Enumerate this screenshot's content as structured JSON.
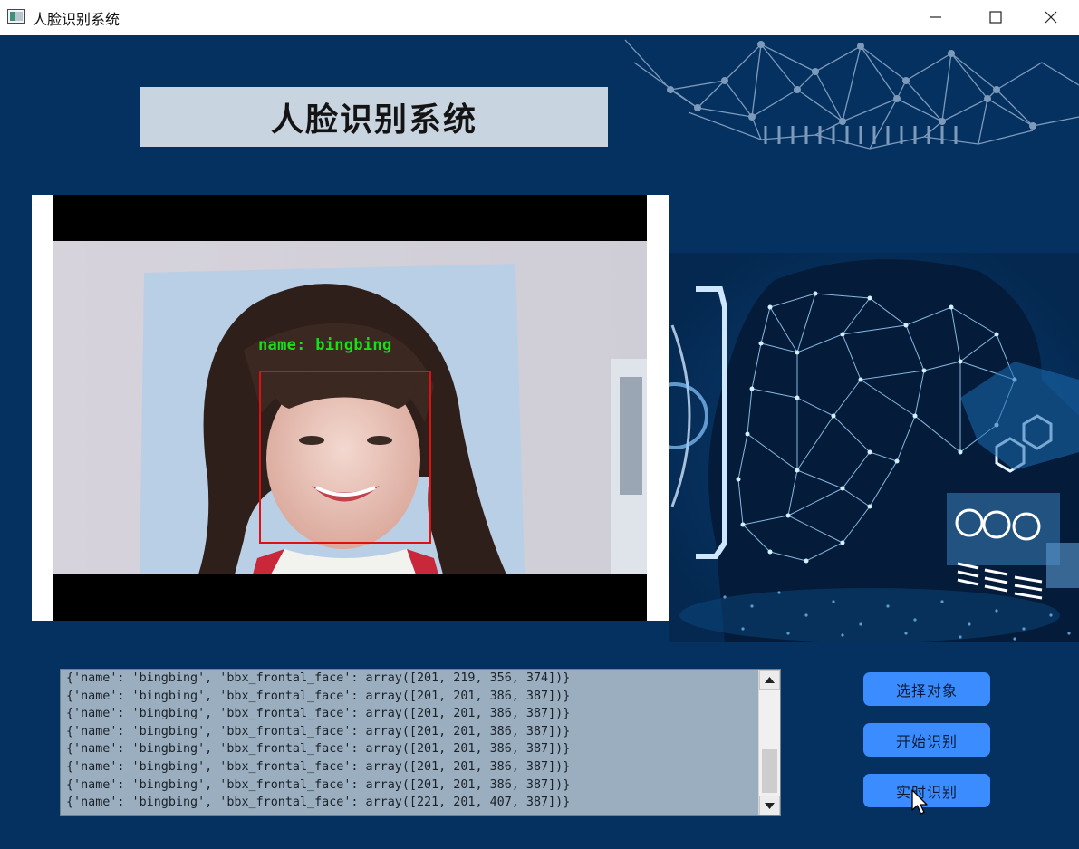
{
  "window": {
    "title": "人脸识别系统",
    "controls": {
      "minimize": "minimize",
      "maximize": "maximize",
      "close": "close"
    }
  },
  "header": {
    "title": "人脸识别系统"
  },
  "video": {
    "label": "name: bingbing"
  },
  "log": {
    "lines": [
      "{'name': 'bingbing', 'bbx_frontal_face': array([201, 219, 356, 374])}",
      "{'name': 'bingbing', 'bbx_frontal_face': array([201, 201, 386, 387])}",
      "{'name': 'bingbing', 'bbx_frontal_face': array([201, 201, 386, 387])}",
      "{'name': 'bingbing', 'bbx_frontal_face': array([201, 201, 386, 387])}",
      "{'name': 'bingbing', 'bbx_frontal_face': array([201, 201, 386, 387])}",
      "{'name': 'bingbing', 'bbx_frontal_face': array([201, 201, 386, 387])}",
      "{'name': 'bingbing', 'bbx_frontal_face': array([201, 201, 386, 387])}",
      "{'name': 'bingbing', 'bbx_frontal_face': array([221, 201, 407, 387])}"
    ]
  },
  "buttons": {
    "select_object": "选择对象",
    "start_recognition": "开始识别",
    "realtime_recognition": "实时识别"
  },
  "colors": {
    "background": "#053161",
    "button": "#3a8cff",
    "title_panel": "#c8d4df",
    "log_background": "#9aaebf",
    "face_box": "#e01010",
    "name_label": "#18e018"
  }
}
